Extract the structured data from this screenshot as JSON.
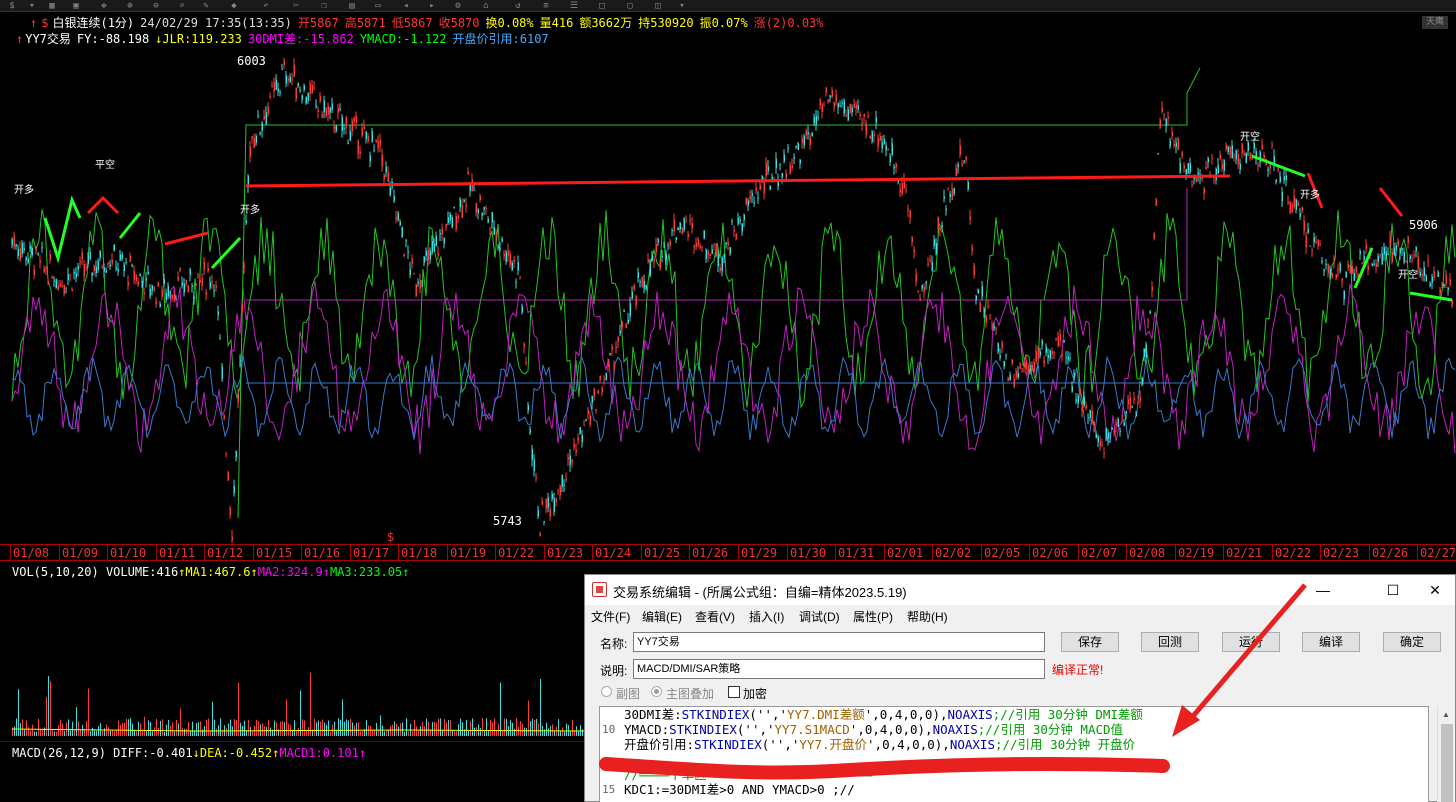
{
  "header": {
    "symbol_icon": "dollar-icon",
    "title": "白银连续(1分)",
    "datetime": "24/02/29 17:35(13:35)",
    "open": "开5867",
    "high": "高5871",
    "low": "低5867",
    "close": "收5870",
    "turnover": "换0.08%",
    "volume": "量416",
    "amount": "额3662万",
    "hold": "持530920",
    "amplitude": "振0.07%",
    "change": "涨(2)0.03%",
    "logo": "天鹰"
  },
  "indicators": {
    "name": "YY7交易",
    "fy": "FY:-88.198",
    "jlr": "JLR:119.233",
    "dmi": "30DMI差:-15.862",
    "ymacd": "YMACD:-1.122",
    "open_ref": "开盘价引用:6107"
  },
  "price_labels": {
    "high": "6003",
    "low": "5743",
    "right": "5906"
  },
  "chart_data": {
    "type": "line",
    "x_ticks": [
      "01/08",
      "01/09",
      "01/10",
      "01/11",
      "01/12",
      "01/15",
      "01/16",
      "01/17",
      "01/18",
      "01/19",
      "01/22",
      "01/23",
      "01/24",
      "01/25",
      "01/26",
      "01/29",
      "01/30",
      "01/31",
      "02/01",
      "02/02",
      "02/05",
      "02/06",
      "02/07",
      "02/08",
      "02/19",
      "02/21",
      "02/22",
      "02/23",
      "02/26",
      "02/27"
    ],
    "high_price": 6003,
    "low_price": 5743,
    "right_price": 5906,
    "ylim": [
      5735,
      6010
    ]
  },
  "volume": {
    "label": "VOL(5,10,20)",
    "vol": "VOLUME:416",
    "ma1": "MA1:467.6",
    "ma2": "MA2:324.9",
    "ma3": "MA3:233.05"
  },
  "macd": {
    "label": "MACD(26,12,9)",
    "diff": "DIFF:-0.401",
    "dea": "DEA:-0.452",
    "macd1": "MACD1:0.101"
  },
  "dialog": {
    "title": "交易系统编辑 - (所属公式组：自编=精体2023.5.19)",
    "menu": [
      "文件(F)",
      "编辑(E)",
      "查看(V)",
      "插入(I)",
      "调试(D)",
      "属性(P)",
      "帮助(H)"
    ],
    "name_label": "名称:",
    "name_value": "YY7交易",
    "desc_label": "说明:",
    "desc_value": "MACD/DMI/SAR策略",
    "status": "编译正常!",
    "buttons": [
      "保存",
      "回测",
      "运行",
      "编译",
      "确定"
    ],
    "radio_sub": "副图",
    "radio_main": "主图叠加",
    "check_encrypt": "加密",
    "code": [
      {
        "num": "",
        "parts": [
          [
            "txt",
            "30DMI差:"
          ],
          [
            "kw",
            "STKINDIEX"
          ],
          [
            "txt",
            "('','"
          ],
          [
            "str",
            "YY7.DMI差额"
          ],
          [
            "txt",
            "',0,4,0,0),"
          ],
          [
            "kw",
            "NOAXIS"
          ],
          [
            "cm",
            ";//引用     30分钟 DMI差额"
          ]
        ]
      },
      {
        "num": "10",
        "parts": [
          [
            "txt",
            "YMACD:"
          ],
          [
            "kw",
            "STKINDIEX"
          ],
          [
            "txt",
            "('','"
          ],
          [
            "str",
            "YY7.S1MACD"
          ],
          [
            "txt",
            "',0,4,0,0),"
          ],
          [
            "kw",
            "NOAXIS"
          ],
          [
            "cm",
            ";//引用     30分钟 MACD值"
          ]
        ]
      },
      {
        "num": "",
        "parts": [
          [
            "txt",
            "开盘价引用:"
          ],
          [
            "kw",
            "STKINDIEX"
          ],
          [
            "txt",
            "('','"
          ],
          [
            "str",
            "YY7.开盘价"
          ],
          [
            "txt",
            "',0,4,0,0),"
          ],
          [
            "kw",
            "NOAXIS"
          ],
          [
            "cm",
            ";//引用     30分钟 开盘价"
          ]
        ]
      },
      {
        "num": "",
        "parts": []
      },
      {
        "num": "",
        "parts": [
          [
            "cm",
            "//════下单区══════════════════════"
          ]
        ]
      },
      {
        "num": "15",
        "parts": [
          [
            "txt",
            "KDC1:=30DMI差>0 AND YMACD>0 ;//"
          ]
        ]
      }
    ]
  }
}
